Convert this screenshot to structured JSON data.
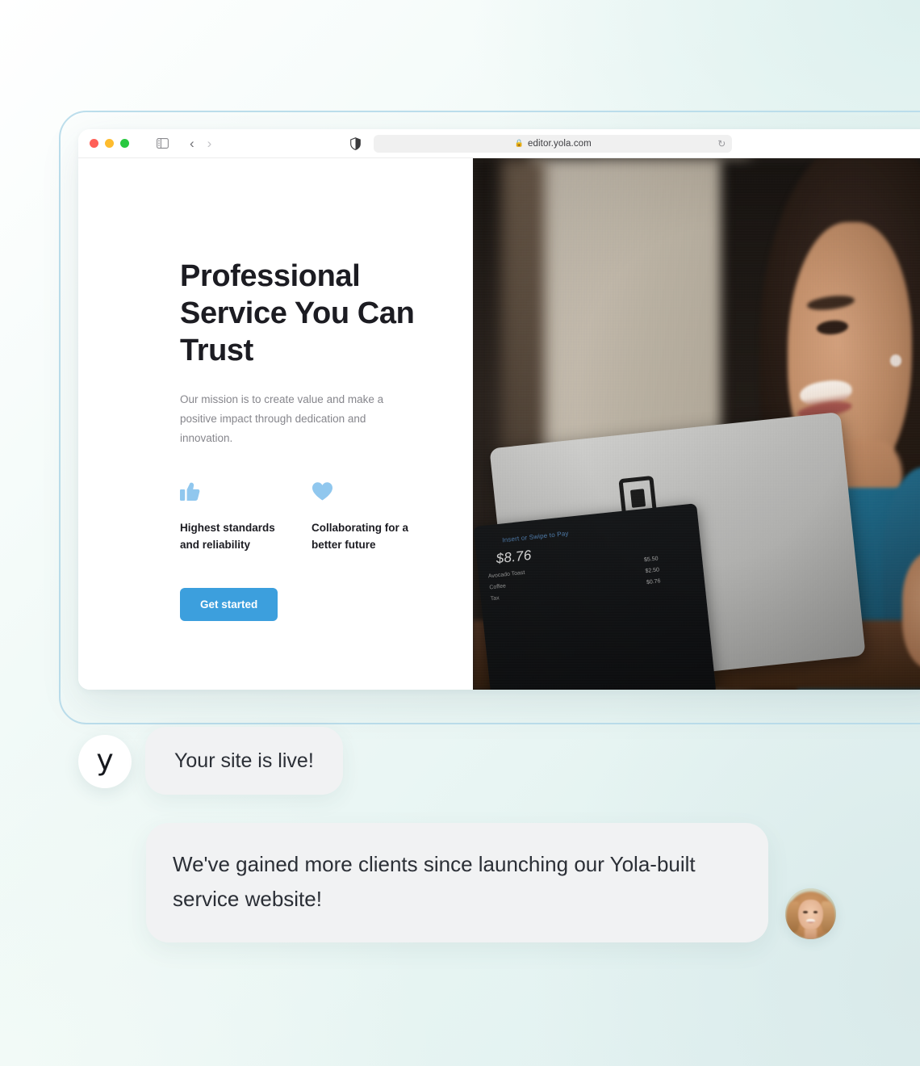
{
  "background": {
    "accent_mint": "#e0f0f0",
    "frame_border": "#bcdeec"
  },
  "browser": {
    "traffic_lights": [
      "close",
      "minimize",
      "maximize"
    ],
    "traffic_colors": {
      "red": "#ff5f57",
      "yellow": "#febc2e",
      "green": "#28c840"
    },
    "sidebar_toggle_icon": "sidebar-icon",
    "back_icon": "‹",
    "forward_icon": "›",
    "shield_icon": "shield-icon",
    "url_lock_icon": "🔒",
    "url": "editor.yola.com",
    "reload_icon": "↻"
  },
  "site": {
    "headline": "Professional Service You Can Trust",
    "subtext": "Our mission is to create value and make a positive impact through dedication and innovation.",
    "features": [
      {
        "icon": "thumbs-up-icon",
        "label": "Highest standards and reliability"
      },
      {
        "icon": "heart-icon",
        "label": "Collaborating for a better future"
      }
    ],
    "cta_label": "Get started",
    "cta_color": "#3c9fdd",
    "feature_icon_color": "#90c7ee"
  },
  "hero_photo": {
    "alt": "Smiling woman in a blue top holding a Square POS terminal",
    "pos_terminal": {
      "prompt": "Insert or Swipe to Pay",
      "total": "$8.76",
      "line_items": [
        {
          "name": "Avocado Toast",
          "price": "$5.50"
        },
        {
          "name": "Coffee",
          "price": "$2.50"
        },
        {
          "name": "Tax",
          "price": "$0.76"
        }
      ]
    }
  },
  "chat": {
    "messages": [
      {
        "avatar": "yola-logo",
        "logo_glyph": "y",
        "text": "Your site is live!"
      },
      {
        "avatar": "user-photo",
        "text": "We've gained more clients since launching our Yola-built service website!"
      }
    ]
  }
}
